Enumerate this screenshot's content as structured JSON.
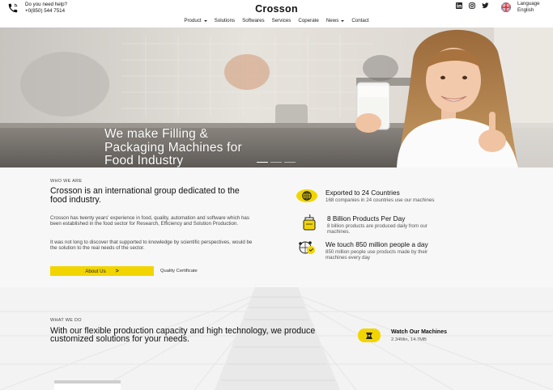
{
  "topbar": {
    "help_title": "Do you need help?",
    "help_phone": "+0(850) 544 7514",
    "brand": "Crosson",
    "language_label": "Language",
    "language_value": "English",
    "socials": [
      "linkedin-icon",
      "instagram-icon",
      "twitter-icon"
    ]
  },
  "nav": {
    "items": [
      {
        "label": "Product",
        "dropdown": true
      },
      {
        "label": "Solutions",
        "dropdown": false
      },
      {
        "label": "Softwares",
        "dropdown": false
      },
      {
        "label": "Services",
        "dropdown": false
      },
      {
        "label": "Coperate",
        "dropdown": false
      },
      {
        "label": "News",
        "dropdown": true
      },
      {
        "label": "Contact",
        "dropdown": false
      }
    ]
  },
  "hero": {
    "title_line1": "We make Filling &",
    "title_line2": "Packaging Machines for",
    "title_line3": "Food Industry",
    "slides": 3,
    "active_slide": 1
  },
  "who": {
    "eyebrow": "WHO WE ARE",
    "title": "Crosson is an international group dedicated to the food industry.",
    "para1": "Crosson has twenty years' experience in food, quality, automation and software which has been established in the food sector for Research, Efficiency and Solution Production.",
    "para2": "It was not long to discover that supported to knowledge by scientific perspectives, would be the solution to the real needs of the sector.",
    "about_button": "About Us",
    "about_arrow": ">",
    "quality_link": "Quality Certificate",
    "features": [
      {
        "icon": "globe-badge-icon",
        "title": "Exported to 24 Countries",
        "desc": "168 companies in 24 countries use our machines"
      },
      {
        "icon": "product-jar-icon",
        "title": "8 Billion Products Per Day",
        "desc": "8 billion products are produced daily from our machines."
      },
      {
        "icon": "people-network-icon",
        "title": "We touch 850 million people a day",
        "desc": "850 million people use products made by their machines every day"
      }
    ]
  },
  "what": {
    "eyebrow": "WHAT WE DO",
    "title": "With our flexible production capacity and high technology, we produce customized solutions for your needs.",
    "watch_title": "Watch Our Machines",
    "watch_meta": "2.34Min, 14.7MB"
  },
  "colors": {
    "accent": "#f2d500",
    "text": "#111111",
    "section_bg": "#f7f7f7"
  }
}
